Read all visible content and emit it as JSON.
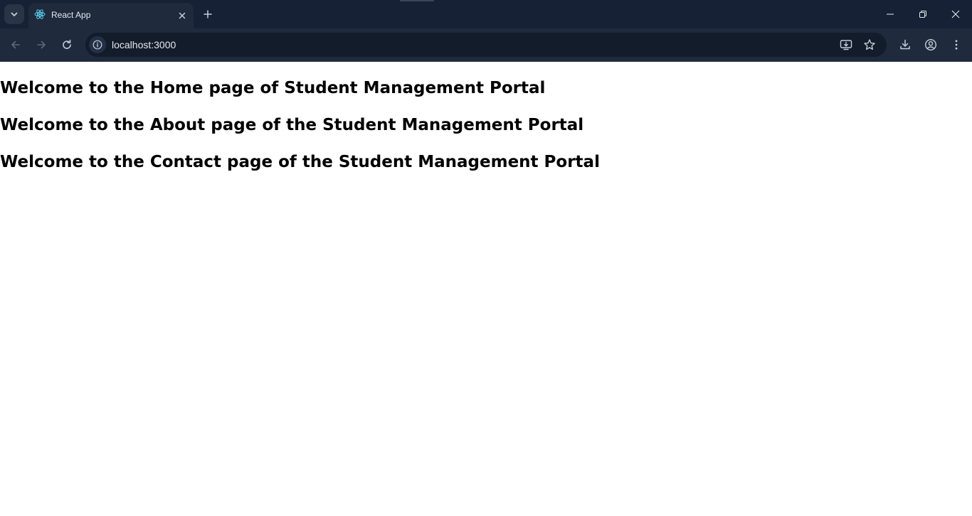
{
  "browser": {
    "tab": {
      "title": "React App",
      "favicon": "react-icon"
    },
    "address_bar": {
      "url": "localhost:3000"
    },
    "colors": {
      "frame": "#172135",
      "toolbar": "#1f2a3d",
      "omnibox": "#131c2b",
      "icon": "#c7cdd8",
      "icon_disabled": "#5e6878",
      "react_accent": "#61dafb"
    },
    "icons": {
      "tab_search": "chevron-down-icon",
      "tab_close": "close-icon",
      "new_tab": "plus-icon",
      "minimize": "minimize-icon",
      "restore": "restore-icon",
      "close_window": "close-icon",
      "back": "arrow-left-icon",
      "forward": "arrow-right-icon",
      "reload": "reload-icon",
      "site_info": "info-icon",
      "install": "install-app-icon",
      "bookmark": "star-icon",
      "downloads": "download-icon",
      "profile": "profile-icon",
      "menu": "kebab-menu-icon"
    }
  },
  "page": {
    "headings": {
      "home": "Welcome to the Home page of Student Management Portal",
      "about": "Welcome to the About page of the Student Management Portal",
      "contact": "Welcome to the Contact page of the Student Management Portal"
    }
  }
}
